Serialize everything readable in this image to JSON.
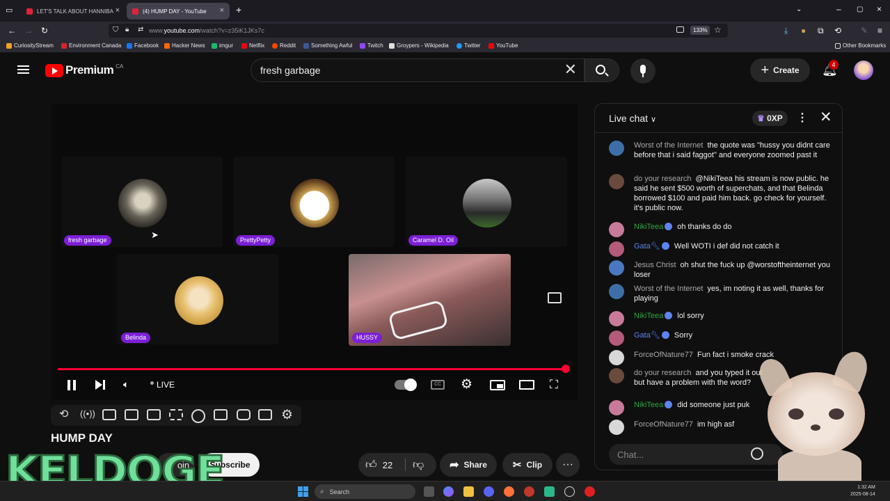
{
  "browser": {
    "tabs": [
      {
        "title": "LET'S TALK ABOUT HANNIBA",
        "active": false
      },
      {
        "title": "(4) HUMP DAY - YouTube",
        "active": true
      }
    ],
    "url_prefix": "www.",
    "url_domain": "youtube.com",
    "url_path": "/watch?v=z35iK1JKs7c",
    "zoom": "133%",
    "bookmarks": [
      {
        "label": "CuriosityStream",
        "color": "#f4a020"
      },
      {
        "label": "Environment Canada",
        "color": "#d8232a"
      },
      {
        "label": "Facebook",
        "color": "#1877f2"
      },
      {
        "label": "Hacker News",
        "color": "#ff6600"
      },
      {
        "label": "imgur",
        "color": "#1bb76e"
      },
      {
        "label": "Netflix",
        "color": "#e50914"
      },
      {
        "label": "Reddit",
        "color": "#ff4500"
      },
      {
        "label": "Something Awful",
        "color": "#3b5998"
      },
      {
        "label": "Twitch",
        "color": "#9146ff"
      },
      {
        "label": "Groypers - Wikipedia",
        "color": "#dddddd"
      },
      {
        "label": "Twitter",
        "color": "#1d9bf0"
      },
      {
        "label": "YouTube",
        "color": "#ff0000"
      }
    ],
    "other_bookmarks": "Other Bookmarks"
  },
  "youtube": {
    "logo_text": "Premium",
    "region": "CA",
    "search_value": "fresh garbage",
    "create_label": "Create",
    "notification_count": "4"
  },
  "player": {
    "participants": [
      {
        "name": "fresh garbage"
      },
      {
        "name": "PrettyPetty"
      },
      {
        "name": "Caramel D. Oil"
      },
      {
        "name": "Belinda"
      },
      {
        "name": "HUSSY"
      }
    ],
    "live_label": "LIVE",
    "progress_fraction": 0.99
  },
  "video": {
    "title": "HUMP DAY",
    "join_label": "oin",
    "subscribe_label": "Subscribe",
    "like_count": "22",
    "share_label": "Share",
    "clip_label": "Clip"
  },
  "chat": {
    "title": "Live chat",
    "xp_label": "0XP",
    "input_placeholder": "Chat...",
    "messages": [
      {
        "author": "Worst of the Internet",
        "text": "the quote was \"hussy you didnt care before that i said faggot\" and everyone zoomed past it",
        "avatar_color": "#3d6ea8",
        "role": "normal"
      },
      {
        "author": "do your research",
        "text": "@NikiTeea his stream is now public. he said he sent $500 worth of superchats, and that Belinda borrowed $100 and paid him back. go check for yourself. it's public now.",
        "avatar_color": "#6b4a3e",
        "role": "normal"
      },
      {
        "author": "NikiTeea",
        "text": "oh thanks do do",
        "avatar_color": "#c97a9a",
        "role": "member"
      },
      {
        "author": "Gata",
        "text": "Well WOTI i def did not catch it",
        "avatar_color": "#b45a7a",
        "role": "mod"
      },
      {
        "author": "Jesus Christ",
        "text": "oh shut the fuck up @worstoftheinternet you loser",
        "avatar_color": "#4a78c0",
        "role": "normal"
      },
      {
        "author": "Worst of the Internet",
        "text": "yes, im noting it as well, thanks for playing",
        "avatar_color": "#3d6ea8",
        "role": "normal"
      },
      {
        "author": "NikiTeea",
        "text": "lol sorry",
        "avatar_color": "#c97a9a",
        "role": "member"
      },
      {
        "author": "Gata",
        "text": "Sorry",
        "avatar_color": "#b45a7a",
        "role": "mod"
      },
      {
        "author": "ForceOfNature77",
        "text": "Fun fact i smoke crack",
        "avatar_color": "#d8d8d8",
        "role": "normal"
      },
      {
        "author": "do your research",
        "text": "and you typed it out",
        "text2": "but have a problem with the word?",
        "avatar_color": "#6b4a3e",
        "role": "normal"
      },
      {
        "author": "NikiTeea",
        "text": "did someone just puk",
        "avatar_color": "#c97a9a",
        "role": "member"
      },
      {
        "author": "ForceOfNature77",
        "text": "im high asf",
        "avatar_color": "#d8d8d8",
        "role": "normal"
      }
    ]
  },
  "taskbar": {
    "search_placeholder": "Search",
    "time": "1:32 AM",
    "date": "2025-08-14"
  },
  "overlay": {
    "watermark": "KELDOGE"
  }
}
